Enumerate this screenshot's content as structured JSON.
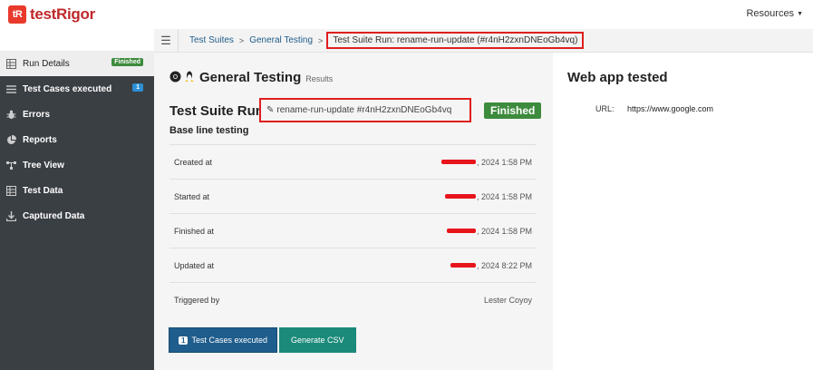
{
  "header": {
    "logo_mark": "tR",
    "logo_text": "testRigor",
    "resources_label": "Resources"
  },
  "sidebar": {
    "items": [
      {
        "label": "Run Details",
        "badge": "Finished"
      },
      {
        "label": "Test Cases executed",
        "badge": "1"
      },
      {
        "label": "Errors"
      },
      {
        "label": "Reports"
      },
      {
        "label": "Tree View"
      },
      {
        "label": "Test Data"
      },
      {
        "label": "Captured Data"
      }
    ]
  },
  "breadcrumb": {
    "items": [
      "Test Suites",
      "General Testing"
    ],
    "separator": ">",
    "current": "Test Suite Run: rename-run-update (#r4nH2zxnDNEoGb4vq)"
  },
  "main": {
    "heading_title": "General Testing",
    "heading_sub": "Results",
    "suite_title": "Test Suite Run",
    "suite_name": "rename-run-update #r4nH2zxnDNEoGb4vq",
    "status": "Finished",
    "baseline": "Base line testing",
    "rows": [
      {
        "label": "Created at",
        "value": ", 2024 1:58 PM"
      },
      {
        "label": "Started at",
        "value": ", 2024 1:58 PM"
      },
      {
        "label": "Finished at",
        "value": ", 2024 1:58 PM"
      },
      {
        "label": "Updated at",
        "value": ", 2024 8:22 PM"
      },
      {
        "label": "Triggered by",
        "value": "Lester Coyoy"
      }
    ],
    "buttons": {
      "test_cases_count": "1",
      "test_cases_label": "Test Cases executed",
      "csv_label": "Generate CSV"
    }
  },
  "web_app": {
    "title": "Web app tested",
    "url_label": "URL:",
    "url_value": "https://www.google.com"
  },
  "colors": {
    "accent_red": "#e01e1e",
    "brand_red": "#c0282a",
    "sidebar_bg": "#3a3f44",
    "status_green": "#3d8b3d",
    "primary_blue": "#1f5d8c",
    "teal": "#1b8a7a"
  }
}
